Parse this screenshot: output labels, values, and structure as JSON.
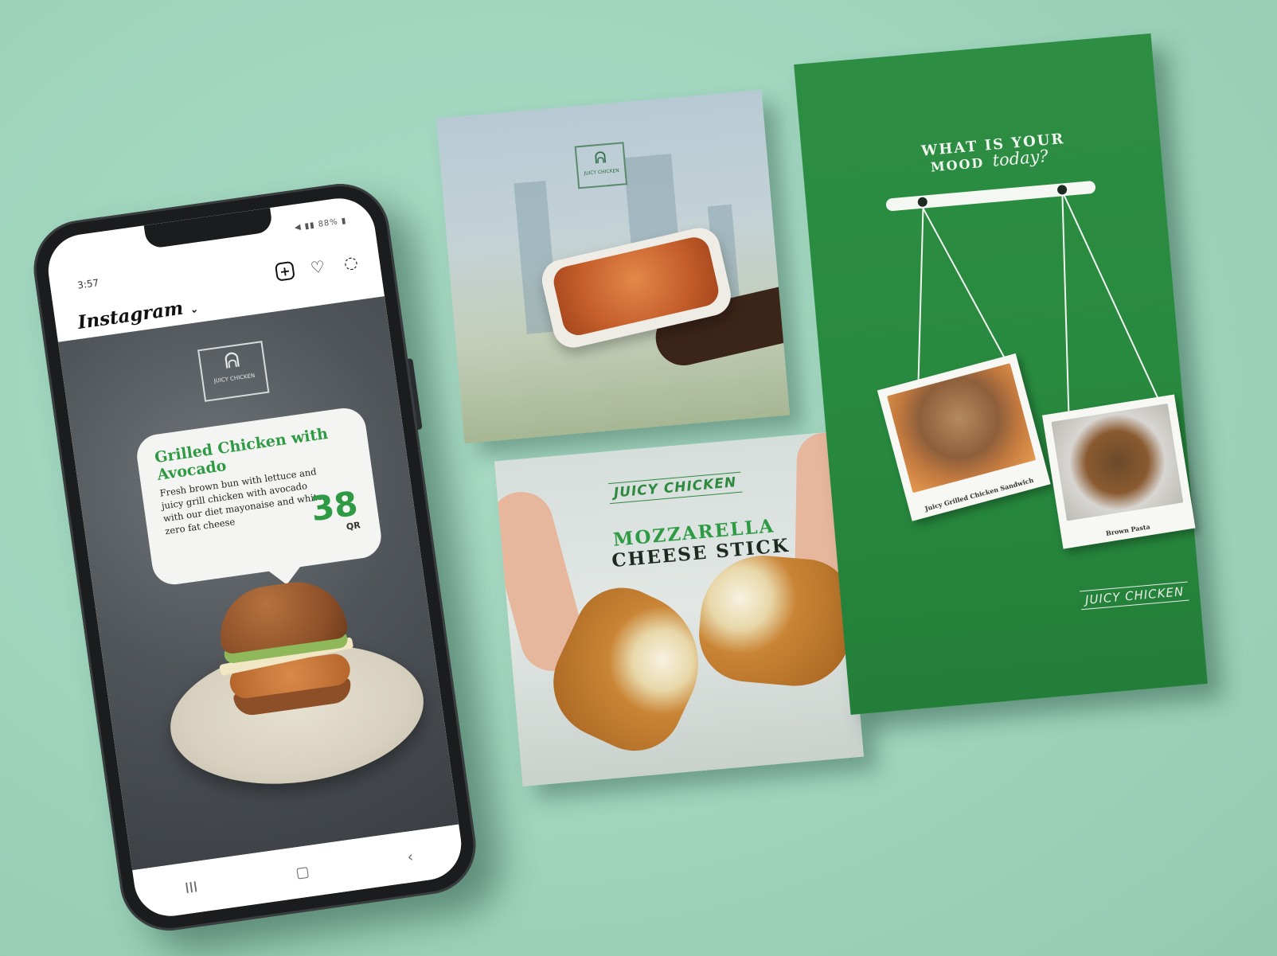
{
  "phone": {
    "status_time": "3:57",
    "status_icons": "◀ ▮▮ 88% ▮",
    "app_name": "Instagram",
    "post": {
      "title": "Grilled Chicken with Avocado",
      "description": "Fresh brown bun with lettuce and juicy grill chicken with avocado with our diet mayonaise and white zero fat cheese",
      "price": "38",
      "currency": "QR",
      "logo_text": "JUICY CHICKEN"
    },
    "nav": [
      "III",
      "▢",
      "‹"
    ]
  },
  "posters": {
    "pasta_logo_text": "JUICY CHICKEN",
    "mozz_brand": "JUICY CHICKEN",
    "mozz_title_line1": "MOZZARELLA",
    "mozz_title_line2": "CHEESE STICK"
  },
  "flyer": {
    "question_line1": "WHAT IS YOUR",
    "question_line2": "MOOD",
    "question_script": "today?",
    "item1_caption": "Juicy Grilled Chicken Sandwich",
    "item2_caption": "Brown Pasta",
    "brand": "JUICY CHICKEN"
  },
  "colors": {
    "brand_green": "#2e9a44",
    "background": "#a9dcc6"
  }
}
